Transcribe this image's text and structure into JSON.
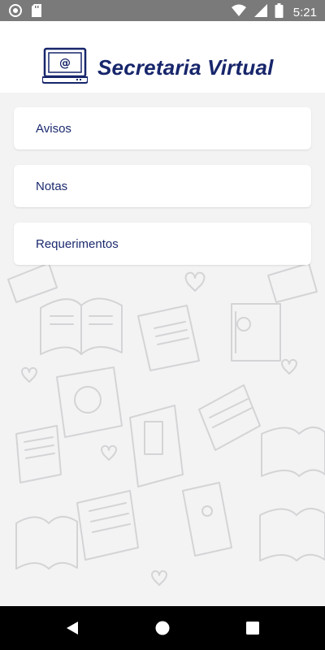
{
  "status_bar": {
    "time": "5:21",
    "icons": [
      "notification-icon",
      "sd-card-icon",
      "wifi-icon",
      "signal-icon",
      "battery-icon"
    ]
  },
  "header": {
    "title": "Secretaria Virtual",
    "logo_icon": "laptop-at-icon"
  },
  "menu": {
    "items": [
      {
        "label": "Avisos"
      },
      {
        "label": "Notas"
      },
      {
        "label": "Requerimentos"
      }
    ]
  },
  "nav_bar": {
    "buttons": [
      "back-icon",
      "home-icon",
      "recents-icon"
    ]
  },
  "colors": {
    "title": "#17266b",
    "menu_text": "#1b2a6e",
    "status_bar": "#7a7a7a",
    "nav_bar": "#000000",
    "card": "#ffffff",
    "background": "#f3f3f4"
  }
}
